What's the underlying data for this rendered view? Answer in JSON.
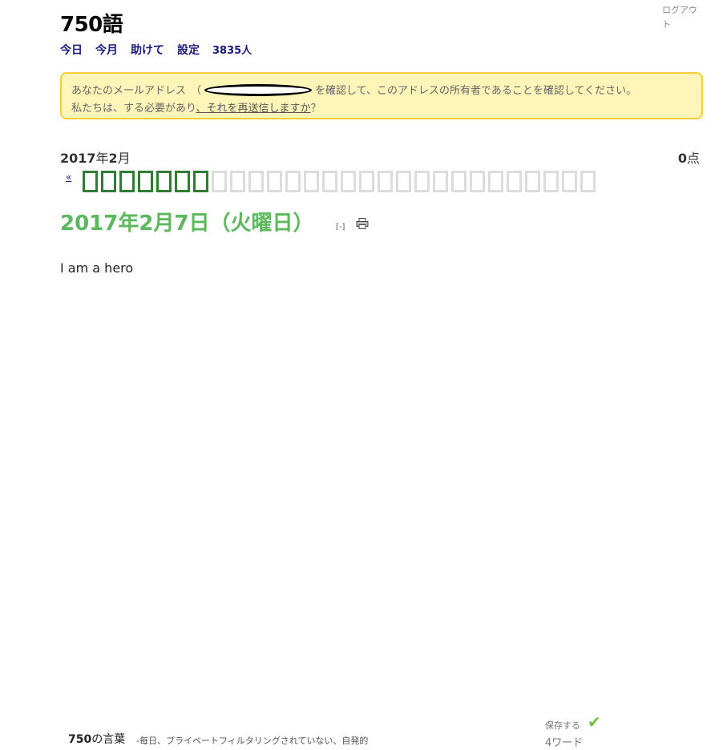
{
  "header": {
    "logout_label": "ログアウト",
    "site_title": "750語"
  },
  "nav": {
    "today": "今日",
    "this_month": "今月",
    "help": "助けて",
    "settings": "設定",
    "user_count": "3835人"
  },
  "notice": {
    "text_before": "あなたのメールアドレス",
    "open_paren": "（",
    "text_after": "を確認して、このアドレスの所有者であることを確認してください。",
    "line2_before": "私たちは、する必要があり",
    "resend_link": "、それを再送信しますか",
    "line2_after": "？"
  },
  "month": {
    "year": "2017",
    "year_suffix": "年",
    "month": "2",
    "month_suffix": "月"
  },
  "points": {
    "value": "0",
    "suffix": "点"
  },
  "calendar": {
    "prev_label": "«",
    "days_done": 7,
    "days_total": 28
  },
  "entry": {
    "date_heading": "2017年2月7日（火曜日）",
    "collapse_label": "[-]",
    "text": "I am a hero"
  },
  "footer": {
    "brand_number": "750",
    "brand_suffix": "の言葉",
    "tagline": "-毎日、プライベートフィルタリングされていない、自発的",
    "save_label": "保存する",
    "word_count": "4ワード"
  },
  "colors": {
    "accent_green": "#5cb85c",
    "day_done": "#2e7d32",
    "day_empty": "#dcdcdc",
    "notice_bg": "#fff5b8",
    "notice_border": "#f2cf3a",
    "nav_link": "#1a1a7a",
    "check": "#6fbf40"
  }
}
